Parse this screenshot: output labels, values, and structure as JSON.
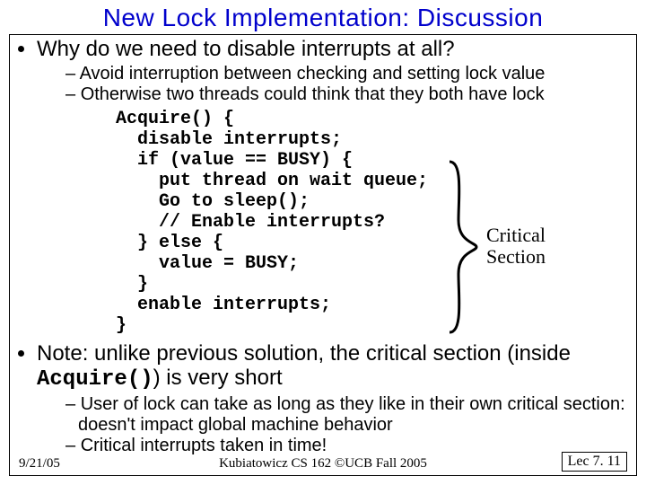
{
  "title": "New Lock Implementation: Discussion",
  "bullet1": "Why do we need to disable interrupts at all?",
  "sub1a": "Avoid interruption between checking and setting lock value",
  "sub1b": "Otherwise two threads could think that they both have lock",
  "code": "Acquire() {\n  disable interrupts;\n  if (value == BUSY) {\n    put thread on wait queue;\n    Go to sleep();\n    // Enable interrupts?\n  } else {\n    value = BUSY;\n  }\n  enable interrupts;\n}",
  "critical_label_l1": "Critical",
  "critical_label_l2": "Section",
  "bullet2_pre": "Note: unlike previous solution, the critical section (inside ",
  "bullet2_code": "Acquire()",
  "bullet2_post": ") is very short",
  "sub2a": "User of lock can take as long as they like in their own critical section: doesn't impact global machine behavior",
  "sub2b": "Critical interrupts taken in time!",
  "footer_date": "9/21/05",
  "footer_center": "Kubiatowicz CS 162 ©UCB Fall 2005",
  "footer_right": "Lec 7. 11"
}
